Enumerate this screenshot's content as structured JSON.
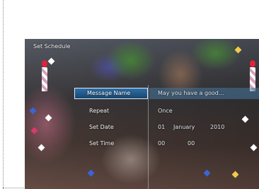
{
  "screen": {
    "title": "Set Schedule"
  },
  "menu": {
    "items": [
      {
        "label": "Message Name",
        "selected": true
      },
      {
        "label": "Repeat",
        "selected": false
      },
      {
        "label": "Set Date",
        "selected": false
      },
      {
        "label": "Set Time",
        "selected": false
      }
    ]
  },
  "values": {
    "message_name": "May you have a good...",
    "repeat": "Once",
    "date_day": "01",
    "date_month": "January",
    "date_year": "2010",
    "time_hour": "00",
    "time_minute": "00"
  },
  "colors": {
    "highlight": "#2f6fa8",
    "highlight_border": "#d7e9fa",
    "text": "#f2f2f2"
  }
}
